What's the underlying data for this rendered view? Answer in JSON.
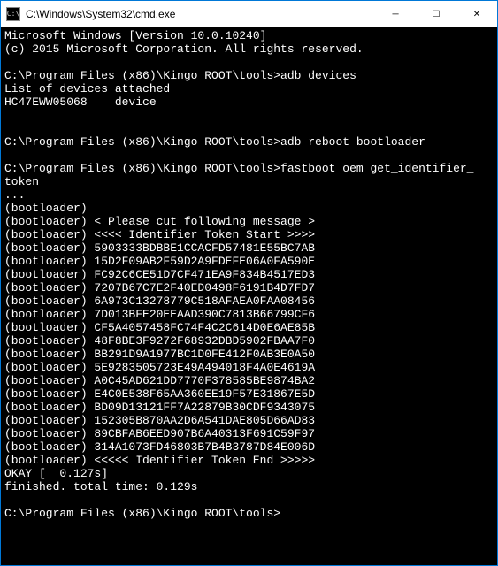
{
  "window": {
    "icon_text": "C:\\",
    "title": "C:\\Windows\\System32\\cmd.exe"
  },
  "controls": {
    "minimize": "─",
    "maximize": "☐",
    "close": "✕"
  },
  "terminal": {
    "lines": [
      "Microsoft Windows [Version 10.0.10240]",
      "(c) 2015 Microsoft Corporation. All rights reserved.",
      "",
      "C:\\Program Files (x86)\\Kingo ROOT\\tools>adb devices",
      "List of devices attached",
      "HC47EWW05068    device",
      "",
      "",
      "C:\\Program Files (x86)\\Kingo ROOT\\tools>adb reboot bootloader",
      "",
      "C:\\Program Files (x86)\\Kingo ROOT\\tools>fastboot oem get_identifier_",
      "token",
      "...",
      "(bootloader)",
      "(bootloader) < Please cut following message >",
      "(bootloader) <<<< Identifier Token Start >>>>",
      "(bootloader) 5903333BDBBE1CCACFD57481E55BC7AB",
      "(bootloader) 15D2F09AB2F59D2A9FDEFE06A0FA590E",
      "(bootloader) FC92C6CE51D7CF471EA9F834B4517ED3",
      "(bootloader) 7207B67C7E2F40ED0498F6191B4D7FD7",
      "(bootloader) 6A973C13278779C518AFAEA0FAA08456",
      "(bootloader) 7D013BFE20EEAAD390C7813B66799CF6",
      "(bootloader) CF5A4057458FC74F4C2C614D0E6AE85B",
      "(bootloader) 48F8BE3F9272F68932DBD5902FBAA7F0",
      "(bootloader) BB291D9A1977BC1D0FE412F0AB3E0A50",
      "(bootloader) 5E9283505723E49A494018F4A0E4619A",
      "(bootloader) A0C45AD621DD7770F378585BE9874BA2",
      "(bootloader) E4C0E538F65AA360EE19F57E31867E5D",
      "(bootloader) BD09D13121FF7A22879B30CDF9343075",
      "(bootloader) 152305B870AA2D6A541DAE805D66AD83",
      "(bootloader) 89CBFAB6EED907B6A40313F691C59F97",
      "(bootloader) 314A1073FD46803B7B4B3787D84E006D",
      "(bootloader) <<<<< Identifier Token End >>>>>",
      "OKAY [  0.127s]",
      "finished. total time: 0.129s",
      "",
      "C:\\Program Files (x86)\\Kingo ROOT\\tools>"
    ]
  }
}
